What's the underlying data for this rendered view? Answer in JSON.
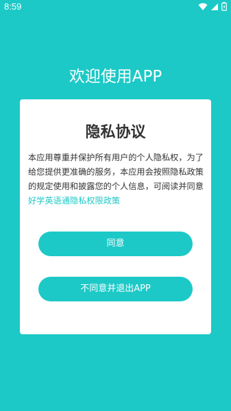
{
  "status_bar": {
    "time": "8:59",
    "icons": [
      "wifi-icon",
      "signal-icon",
      "battery-icon"
    ]
  },
  "welcome": {
    "title": "欢迎使用APP"
  },
  "privacy_dialog": {
    "title": "隐私协议",
    "body_text": "本应用尊重并保护所有用户的个人隐私权，为了给您提供更准确的服务，本应用会按照隐私政策的规定使用和披露您的个人信息，可阅读并同意",
    "policy_link": "好学英语通隐私权限政策",
    "agree_label": "同意",
    "disagree_label": "不同意并退出APP"
  },
  "colors": {
    "accent": "#1cc9c7",
    "card": "#ffffff",
    "text": "#333333"
  }
}
